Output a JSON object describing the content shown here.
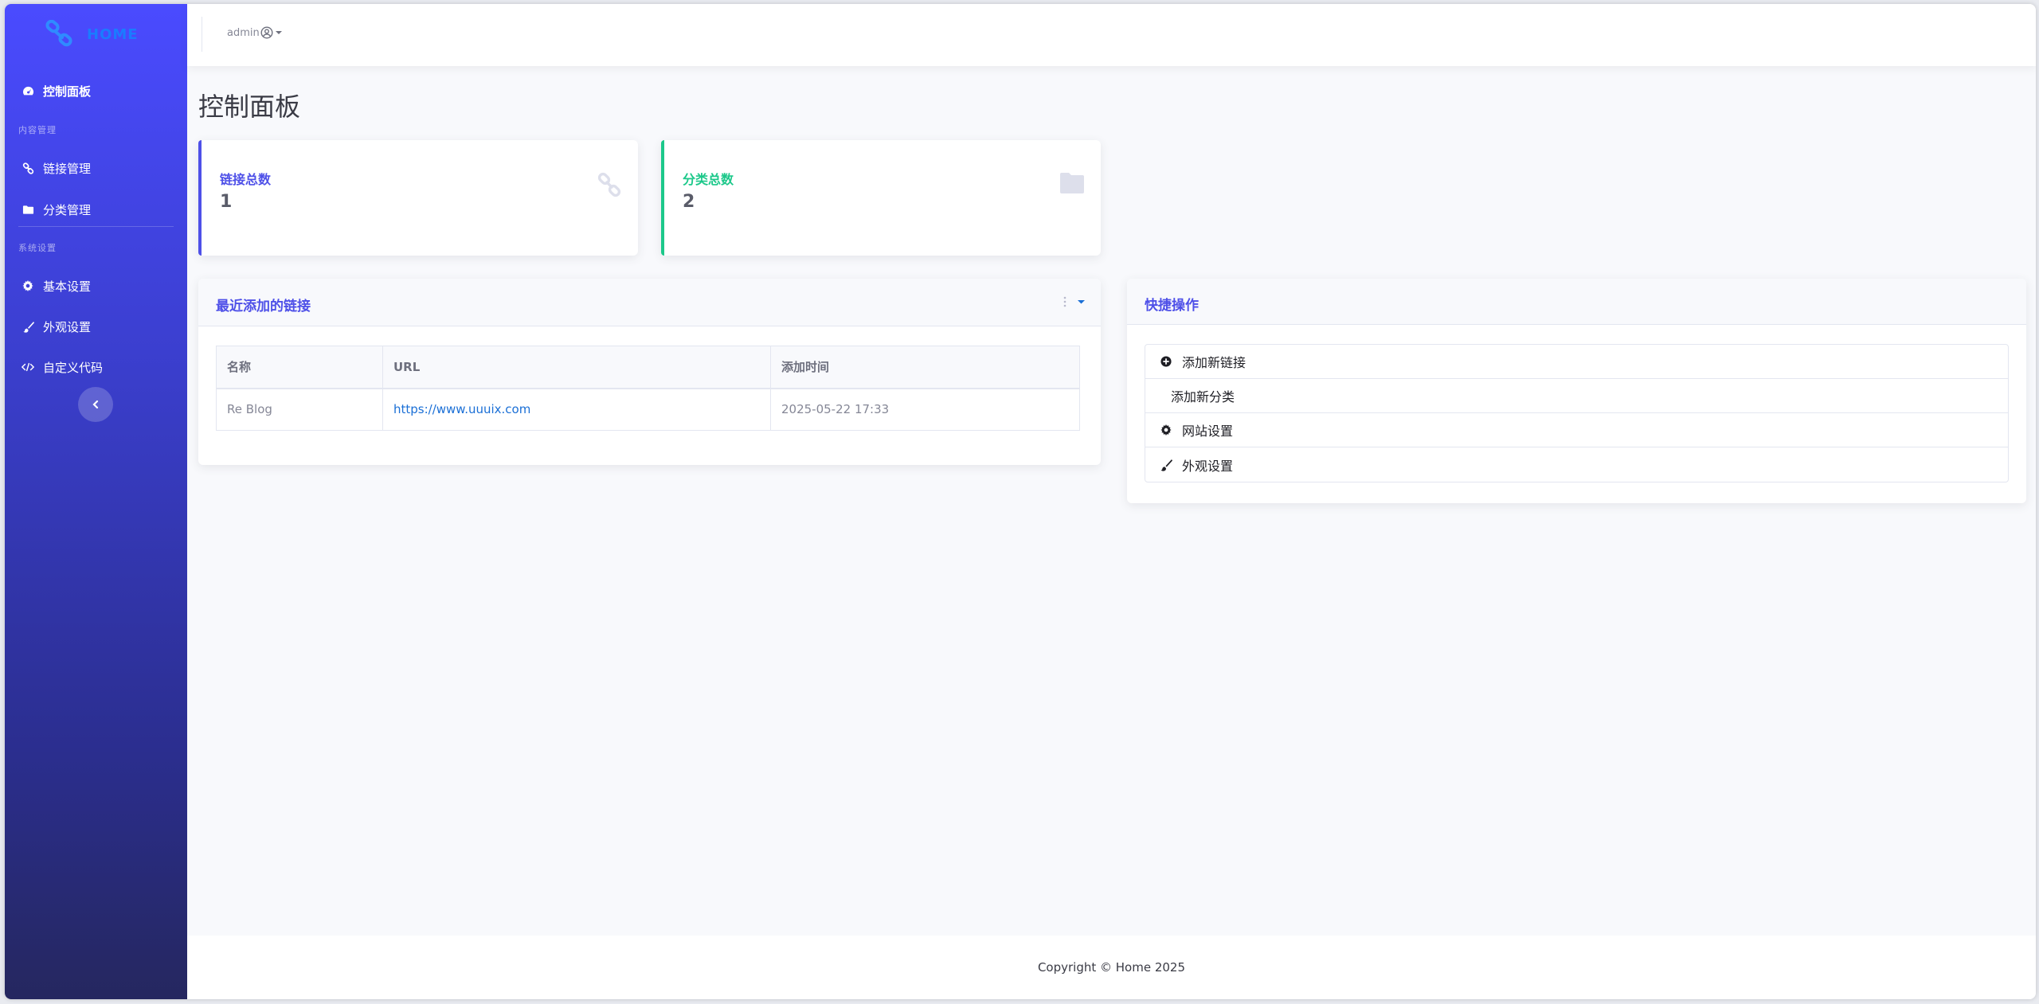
{
  "brand": {
    "name": "HOME",
    "icon": "link-icon"
  },
  "sidebar": {
    "dashboard": {
      "label": "控制面板",
      "icon": "gauge-icon"
    },
    "heading_content": "内容管理",
    "links": {
      "label": "链接管理",
      "icon": "link-icon"
    },
    "categories": {
      "label": "分类管理",
      "icon": "folder-icon"
    },
    "heading_system": "系统设置",
    "basic": {
      "label": "基本设置",
      "icon": "gear-icon"
    },
    "appearance": {
      "label": "外观设置",
      "icon": "brush-icon"
    },
    "custom_code": {
      "label": "自定义代码",
      "icon": "code-icon"
    }
  },
  "topbar": {
    "user": "admin"
  },
  "page": {
    "title": "控制面板"
  },
  "stats": [
    {
      "label": "链接总数",
      "value": "1",
      "color": "#4e50e8",
      "icon": "link-icon"
    },
    {
      "label": "分类总数",
      "value": "2",
      "color": "#1cc88a",
      "icon": "folder-icon"
    }
  ],
  "recent": {
    "title": "最近添加的链接",
    "columns": [
      "名称",
      "URL",
      "添加时间"
    ],
    "rows": [
      {
        "name": "Re Blog",
        "url": "https://www.uuuix.com",
        "time": "2025-05-22 17:33"
      }
    ]
  },
  "quick": {
    "title": "快捷操作",
    "items": [
      {
        "label": "添加新链接",
        "icon": "plus-circle-icon"
      },
      {
        "label": "添加新分类",
        "icon": ""
      },
      {
        "label": "网站设置",
        "icon": "gear-icon"
      },
      {
        "label": "外观设置",
        "icon": "brush-icon"
      }
    ]
  },
  "footer": {
    "text": "Copyright © Home 2025"
  },
  "colors": {
    "accent": "#4e50e8",
    "success": "#1cc88a",
    "link": "#1a6fd6"
  }
}
